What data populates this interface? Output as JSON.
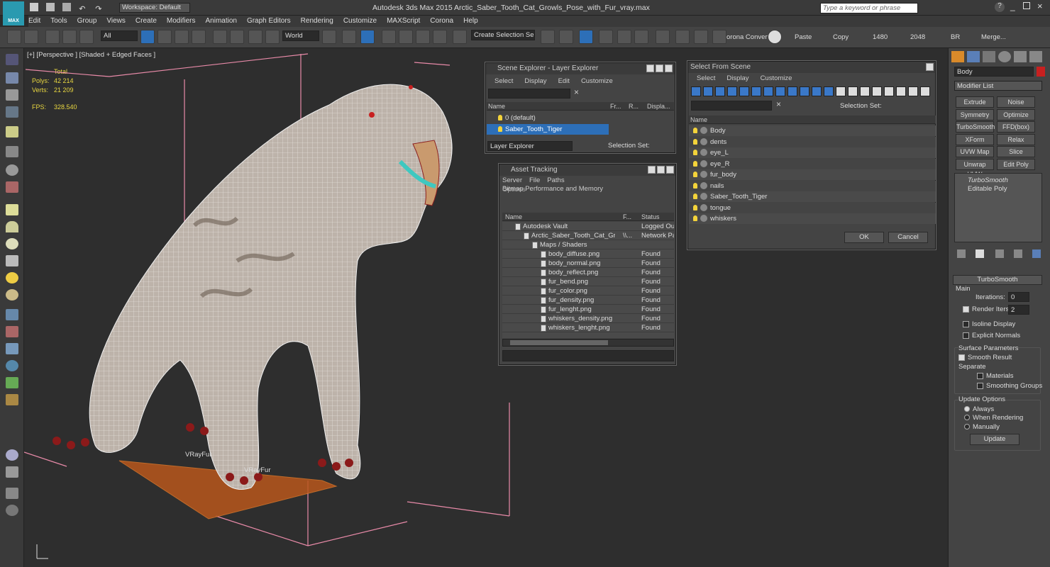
{
  "app": {
    "logo": "MAX",
    "title": "Autodesk 3ds Max  2015     Arctic_Saber_Tooth_Cat_Growls_Pose_with_Fur_vray.max",
    "workspace": "Workspace: Default",
    "search_placeholder": "Type a keyword or phrase"
  },
  "menu": [
    "Edit",
    "Tools",
    "Group",
    "Views",
    "Create",
    "Modifiers",
    "Animation",
    "Graph Editors",
    "Rendering",
    "Customize",
    "MAXScript",
    "Corona",
    "Help"
  ],
  "toolbar": {
    "filter": "All",
    "coord": "World",
    "selection_set": "Create Selection Se",
    "corona": "orona Convert",
    "paste": "Paste",
    "copy": "Copy",
    "w": "1480",
    "h": "2048",
    "br": "BR",
    "merge": "Merge..."
  },
  "viewport": {
    "label": "[+] [Perspective ] [Shaded + Edged Faces ]",
    "stats": {
      "total": "Total",
      "polys_label": "Polys:",
      "polys": "42 214",
      "verts_label": "Verts:",
      "verts": "21 209",
      "fps_label": "FPS:",
      "fps": "328.540"
    },
    "vrayfur1": "VRayFur",
    "vrayfur2": "VRayFur"
  },
  "scene_explorer": {
    "title": "Scene Explorer - Layer Explorer",
    "menu": [
      "Select",
      "Display",
      "Edit",
      "Customize"
    ],
    "col_name": "Name",
    "col_fr": "Fr...",
    "col_r": "R...",
    "col_disp": "Displa...",
    "rows": [
      "0 (default)",
      "Saber_Tooth_Tiger"
    ],
    "footer": "Layer Explorer",
    "selection_set": "Selection Set:"
  },
  "asset_tracking": {
    "title": "Asset Tracking",
    "menu": [
      "Server",
      "File",
      "Paths",
      "Bitmap Performance and Memory"
    ],
    "menu2": "Options",
    "col_name": "Name",
    "col_f": "F...",
    "col_status": "Status",
    "rows": [
      {
        "name": "Autodesk Vault",
        "f": "",
        "status": "Logged Out ("
      },
      {
        "name": "Arctic_Saber_Tooth_Cat_Gro...",
        "f": "\\\\...",
        "status": "Network Path"
      },
      {
        "name": "Maps / Shaders",
        "f": "",
        "status": ""
      },
      {
        "name": "body_diffuse.png",
        "f": "",
        "status": "Found"
      },
      {
        "name": "body_normal.png",
        "f": "",
        "status": "Found"
      },
      {
        "name": "body_reflect.png",
        "f": "",
        "status": "Found"
      },
      {
        "name": "fur_bend.png",
        "f": "",
        "status": "Found"
      },
      {
        "name": "fur_color.png",
        "f": "",
        "status": "Found"
      },
      {
        "name": "fur_density.png",
        "f": "",
        "status": "Found"
      },
      {
        "name": "fur_lenght.png",
        "f": "",
        "status": "Found"
      },
      {
        "name": "whiskers_density.png",
        "f": "",
        "status": "Found"
      },
      {
        "name": "whiskers_lenght.png",
        "f": "",
        "status": "Found"
      }
    ]
  },
  "select_from_scene": {
    "title": "Select From Scene",
    "menu": [
      "Select",
      "Display",
      "Customize"
    ],
    "selection_set": "Selection Set:",
    "col_name": "Name",
    "rows": [
      "Body",
      "dents",
      "eye_L",
      "eye_R",
      "fur_body",
      "nails",
      "Saber_Tooth_Tiger",
      "tongue",
      "whiskers"
    ],
    "ok": "OK",
    "cancel": "Cancel"
  },
  "command_panel": {
    "object_name": "Body",
    "modifier_list": "Modifier List",
    "mods": [
      [
        "Extrude",
        "Noise"
      ],
      [
        "Symmetry",
        "Optimize"
      ],
      [
        "TurboSmooth",
        "FFD(box)"
      ],
      [
        "XForm",
        "Relax"
      ],
      [
        "UVW Map",
        "Slice"
      ],
      [
        "Unwrap UVW",
        "Edit Poly"
      ]
    ],
    "stack": [
      "TurboSmooth",
      "Editable Poly"
    ],
    "rollout": "TurboSmooth",
    "main": "Main",
    "iterations_label": "Iterations:",
    "iterations": "0",
    "render_iters_label": "Render Iters:",
    "render_iters": "2",
    "isoline": "Isoline Display",
    "explicit": "Explicit Normals",
    "surface": "Surface Parameters",
    "smooth": "Smooth Result",
    "separate": "Separate",
    "materials": "Materials",
    "smoothing": "Smoothing Groups",
    "update_opts": "Update Options",
    "always": "Always",
    "when_rendering": "When Rendering",
    "manually": "Manually",
    "update": "Update"
  },
  "colors": {
    "accent": "#2d6fb8",
    "wire": "#ffffff",
    "bbox": "#e88aa8",
    "fur_plane": "#b8561c"
  }
}
